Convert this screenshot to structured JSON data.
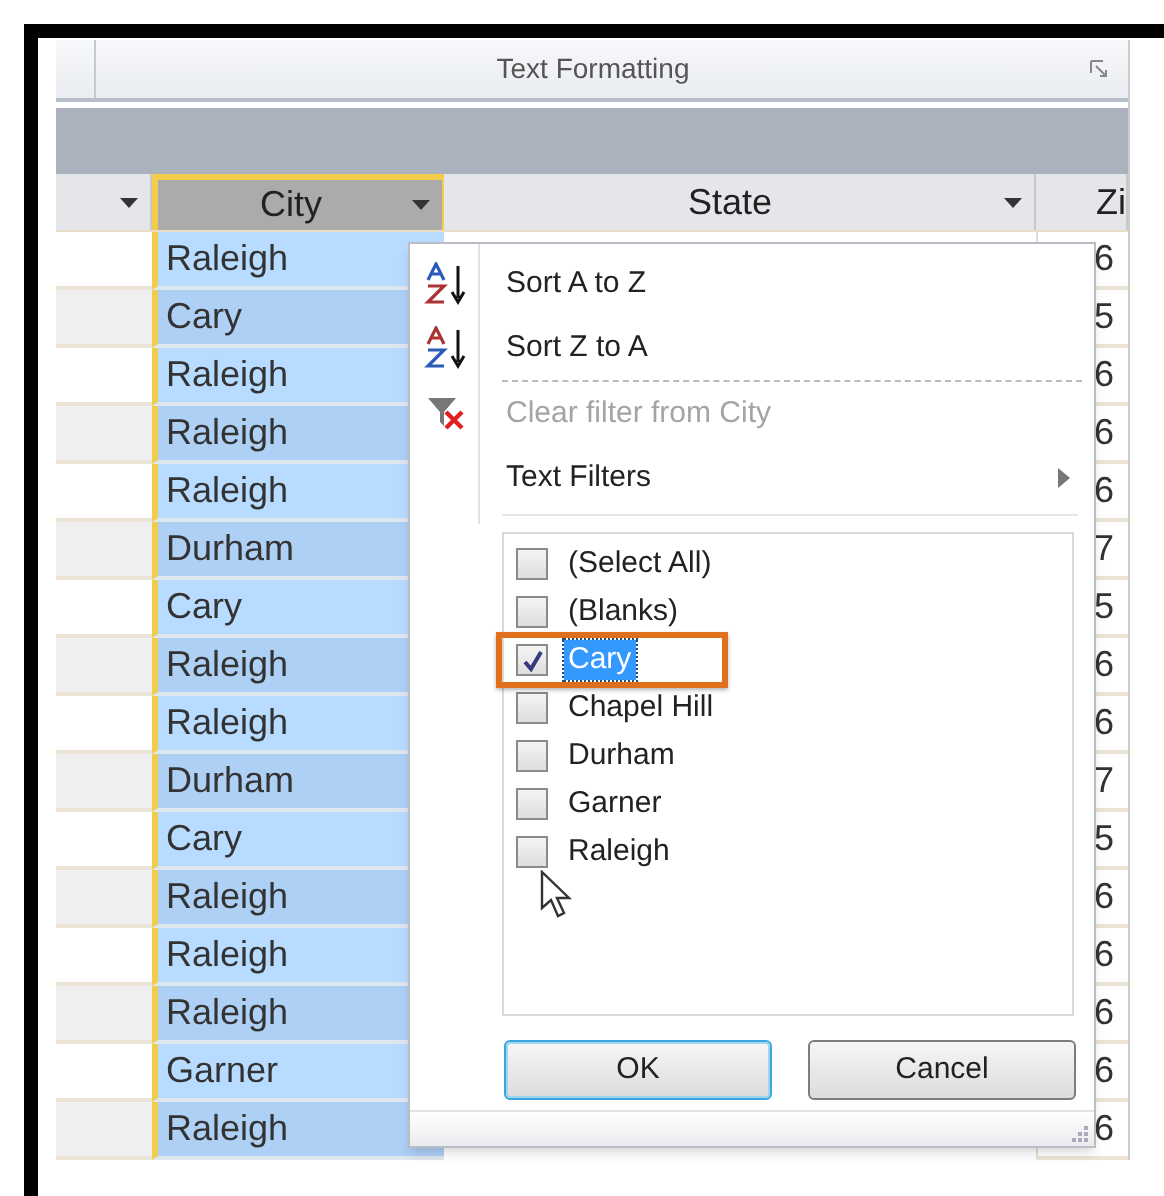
{
  "ribbon": {
    "group_label": "Text Formatting"
  },
  "table": {
    "columns": [
      {
        "kind": "plain"
      },
      {
        "label": "City",
        "kind": "filtered"
      },
      {
        "label": "State",
        "kind": "plain"
      },
      {
        "label": "Zi",
        "kind": "cut"
      }
    ],
    "rows": [
      {
        "city": "Raleigh",
        "zip": "6"
      },
      {
        "city": "Cary",
        "zip": "5"
      },
      {
        "city": "Raleigh",
        "zip": "6"
      },
      {
        "city": "Raleigh",
        "zip": "6"
      },
      {
        "city": "Raleigh",
        "zip": "6"
      },
      {
        "city": "Durham",
        "zip": "7"
      },
      {
        "city": "Cary",
        "zip": "5"
      },
      {
        "city": "Raleigh",
        "zip": "6"
      },
      {
        "city": "Raleigh",
        "zip": "6"
      },
      {
        "city": "Durham",
        "zip": "7"
      },
      {
        "city": "Cary",
        "zip": "5"
      },
      {
        "city": "Raleigh",
        "zip": "6"
      },
      {
        "city": "Raleigh",
        "zip": "6"
      },
      {
        "city": "Raleigh",
        "zip": "6"
      },
      {
        "city": "Garner",
        "zip": "6"
      },
      {
        "city": "Raleigh",
        "zip": "6"
      }
    ]
  },
  "filter_menu": {
    "items": [
      {
        "label": "Sort A to Z",
        "kind": "sort_asc",
        "disabled": false,
        "separator_after": false
      },
      {
        "label": "Sort Z to A",
        "kind": "sort_desc",
        "disabled": false,
        "separator_after": true
      },
      {
        "label": "Clear filter from City",
        "kind": "clear",
        "disabled": true,
        "separator_after": false
      },
      {
        "label": "Text Filters",
        "kind": "submenu",
        "disabled": false,
        "separator_after": false
      }
    ],
    "values": [
      {
        "label": "(Select All)",
        "checked": false,
        "selected": false
      },
      {
        "label": "(Blanks)",
        "checked": false,
        "selected": false
      },
      {
        "label": "Cary",
        "checked": true,
        "selected": true
      },
      {
        "label": "Chapel Hill",
        "checked": false,
        "selected": false
      },
      {
        "label": "Durham",
        "checked": false,
        "selected": false
      },
      {
        "label": "Garner",
        "checked": false,
        "selected": false
      },
      {
        "label": "Raleigh",
        "checked": false,
        "selected": false
      }
    ],
    "buttons": [
      {
        "label": "OK",
        "kind": "default"
      },
      {
        "label": "Cancel",
        "kind": "normal"
      }
    ]
  }
}
